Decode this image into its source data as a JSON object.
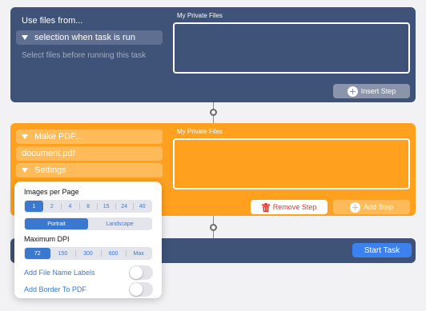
{
  "step1": {
    "title": "Use files from...",
    "source_selector": "selection when task is run",
    "hint": "Select files before running this task",
    "files_label": "My Private Files",
    "insert_label": "Insert Step"
  },
  "step2": {
    "action_selector": "Make PDF...",
    "filename": "document.pdf",
    "settings_label": "Settings",
    "files_label": "My Private Files",
    "remove_label": "Remove Step",
    "add_label": "Add Step"
  },
  "footer": {
    "start_label": "Start Task"
  },
  "settings": {
    "images_per_page_label": "Images per Page",
    "images_per_page_options": [
      "1",
      "2",
      "4",
      "8",
      "15",
      "24",
      "40"
    ],
    "images_per_page_selected": "1",
    "orientation_options": [
      "Portrait",
      "Landscape"
    ],
    "orientation_selected": "Portrait",
    "max_dpi_label": "Maximum DPI",
    "dpi_options": [
      "72",
      "150",
      "300",
      "600",
      "Max"
    ],
    "dpi_selected": "72",
    "add_file_name_labels": "Add File Name Labels",
    "add_file_name_labels_on": false,
    "add_border_to_pdf": "Add Border To PDF",
    "add_border_to_pdf_on": false
  },
  "colors": {
    "step_blue": "#3f5278",
    "step_orange": "#ffa11e",
    "accent_blue": "#3b79d0",
    "danger_red": "#e0362c"
  }
}
